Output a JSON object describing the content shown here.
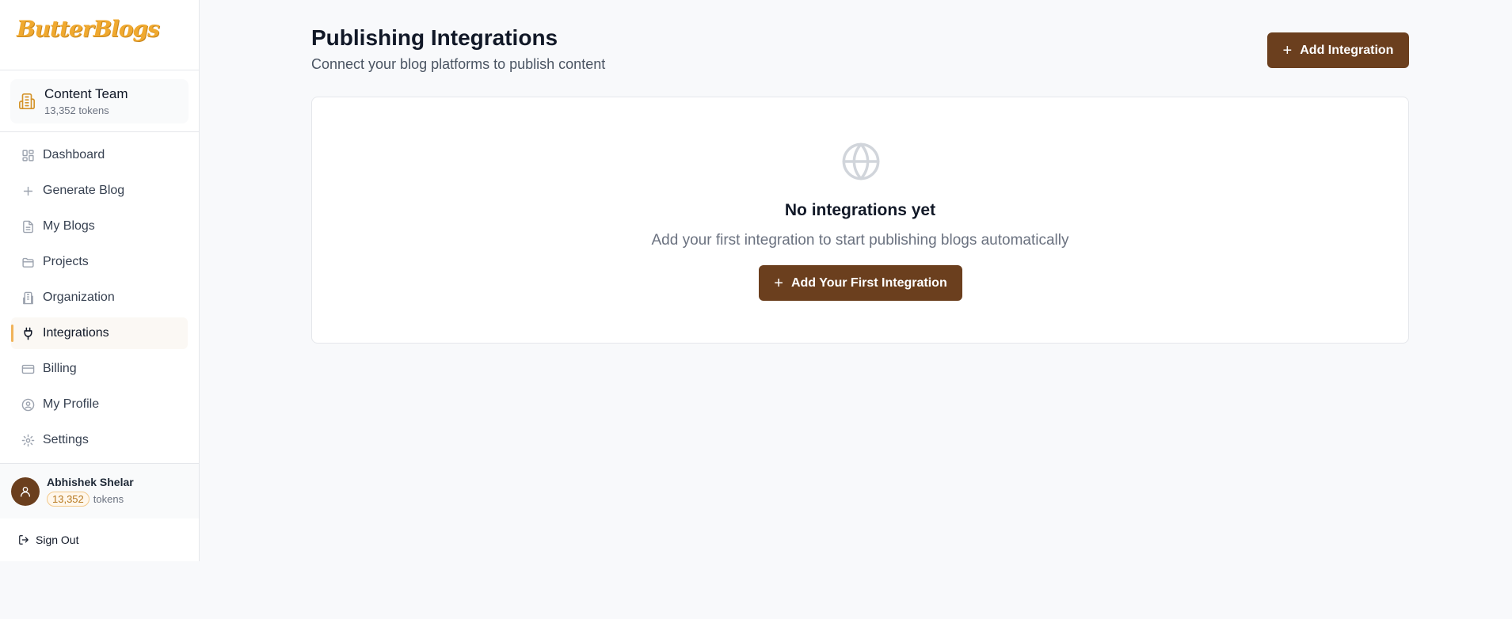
{
  "brand": {
    "logo_text": "ButterBlogs"
  },
  "team": {
    "name": "Content Team",
    "tokens": "13,352 tokens"
  },
  "nav": {
    "items": [
      {
        "label": "Dashboard",
        "icon": "dashboard-icon"
      },
      {
        "label": "Generate Blog",
        "icon": "plus-icon"
      },
      {
        "label": "My Blogs",
        "icon": "document-icon"
      },
      {
        "label": "Projects",
        "icon": "folder-icon"
      },
      {
        "label": "Organization",
        "icon": "building-icon"
      },
      {
        "label": "Integrations",
        "icon": "plug-icon",
        "active": true
      },
      {
        "label": "Billing",
        "icon": "credit-card-icon"
      },
      {
        "label": "My Profile",
        "icon": "user-circle-icon"
      },
      {
        "label": "Settings",
        "icon": "gear-icon"
      }
    ]
  },
  "user": {
    "name": "Abhishek Shelar",
    "token_count": "13,352",
    "token_suffix": "tokens"
  },
  "signout": {
    "label": "Sign Out"
  },
  "header": {
    "title": "Publishing Integrations",
    "subtitle": "Connect your blog platforms to publish content",
    "add_button_label": "Add Integration"
  },
  "empty_state": {
    "icon": "globe-icon",
    "title": "No integrations yet",
    "description": "Add your first integration to start publishing blogs automatically",
    "button_label": "Add Your First Integration"
  },
  "colors": {
    "brand_brown": "#6b3f1e",
    "logo_orange": "#f0a92f",
    "active_indicator": "#f0b35a"
  }
}
